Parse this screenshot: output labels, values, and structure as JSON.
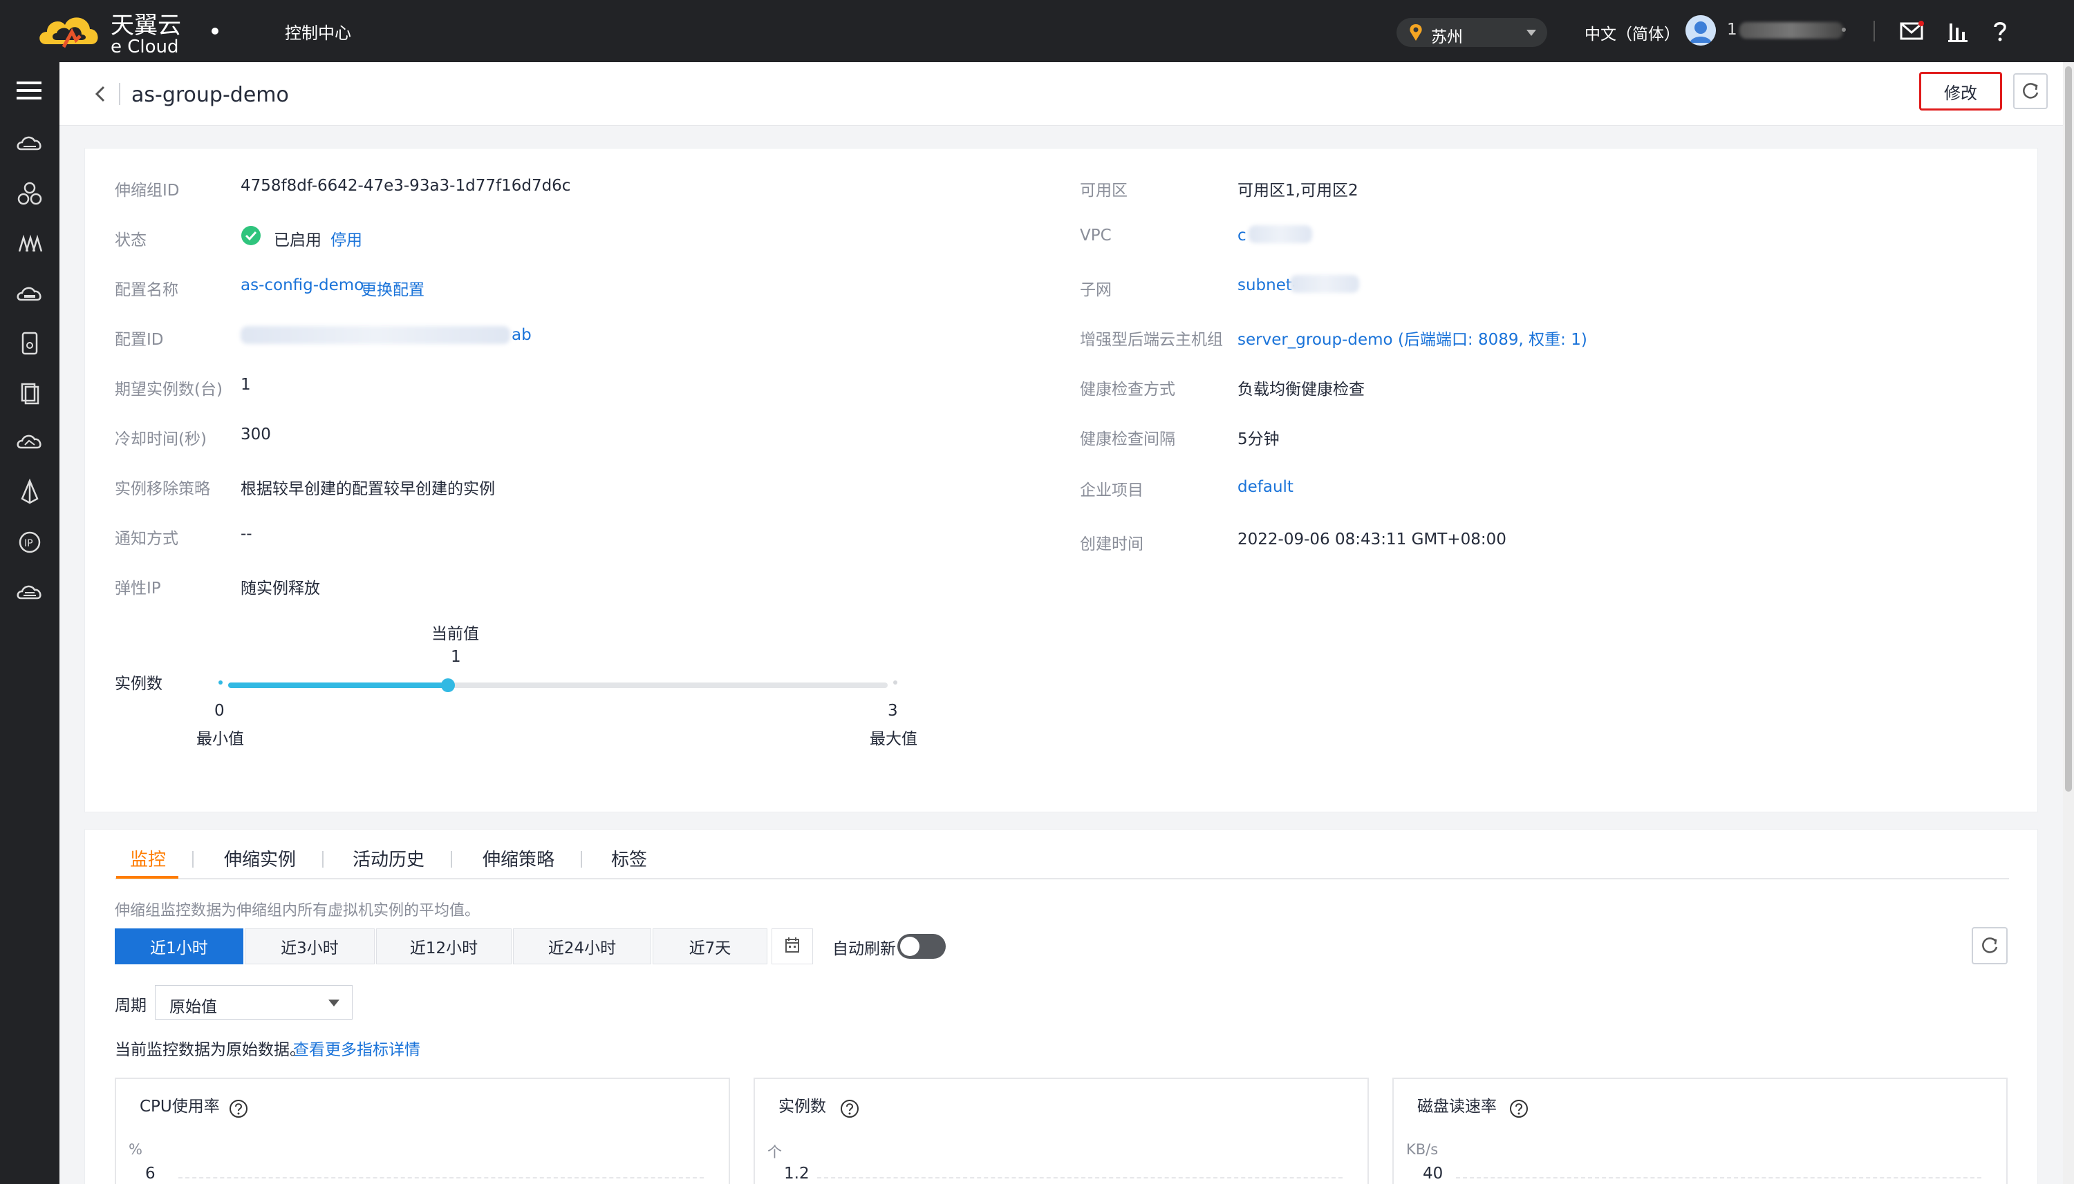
{
  "topbar": {
    "logo_cn": "天翼云",
    "logo_en": "e Cloud",
    "console": "控制中心",
    "region": "苏州",
    "language": "中文（简体）",
    "user": "1"
  },
  "page": {
    "title": "as-group-demo",
    "edit_label": "修改"
  },
  "details": {
    "left": {
      "group_id_label": "伸缩组ID",
      "group_id": "4758f8df-6642-47e3-93a3-1d77f16d7d6c",
      "status_label": "状态",
      "status": "已启用",
      "status_action": "停用",
      "config_name_label": "配置名称",
      "config_name": "as-config-demo",
      "config_change": "更换配置",
      "config_id_label": "配置ID",
      "config_id_tail": "ab",
      "desired_label": "期望实例数(台)",
      "desired": "1",
      "cooldown_label": "冷却时间(秒)",
      "cooldown": "300",
      "removal_label": "实例移除策略",
      "removal": "根据较早创建的配置较早创建的实例",
      "notify_label": "通知方式",
      "notify": "--",
      "eip_label": "弹性IP",
      "eip": "随实例释放"
    },
    "right": {
      "az_label": "可用区",
      "az": "可用区1,可用区2",
      "vpc_label": "VPC",
      "vpc": "c",
      "subnet_label": "子网",
      "subnet": "subnet-",
      "lb_label": "增强型后端云主机组",
      "lb": "server_group-demo (后端端口: 8089, 权重: 1)",
      "hc_label": "健康检查方式",
      "hc": "负载均衡健康检查",
      "hci_label": "健康检查间隔",
      "hci": "5分钟",
      "project_label": "企业项目",
      "project": "default",
      "created_label": "创建时间",
      "created": "2022-09-06 08:43:11 GMT+08:00"
    },
    "instances": {
      "label": "实例数",
      "current_label": "当前值",
      "current": 1,
      "min_label": "最小值",
      "min": 0,
      "max_label": "最大值",
      "max": 3
    }
  },
  "tabs": [
    "监控",
    "伸缩实例",
    "活动历史",
    "伸缩策略",
    "标签"
  ],
  "monitor": {
    "hint": "伸缩组监控数据为伸缩组内所有虚拟机实例的平均值。",
    "ranges": [
      "近1小时",
      "近3小时",
      "近12小时",
      "近24小时",
      "近7天"
    ],
    "auto_refresh": "自动刷新",
    "auto_refresh_on": false,
    "period_label": "周期",
    "period_value": "原始值",
    "raw_note": "当前监控数据为原始数据。",
    "more_link": "查看更多指标详情",
    "metrics": [
      {
        "title": "CPU使用率",
        "unit": "%",
        "top_tick": "6"
      },
      {
        "title": "实例数",
        "unit": "个",
        "top_tick": "1.2"
      },
      {
        "title": "磁盘读速率",
        "unit": "KB/s",
        "top_tick": "40"
      }
    ]
  },
  "colors": {
    "accent": "#1a73d9",
    "active_tab": "#ff7d00",
    "status_ok": "#2fc47d",
    "slider": "#32b9e3",
    "highlight": "#e01b1b"
  }
}
